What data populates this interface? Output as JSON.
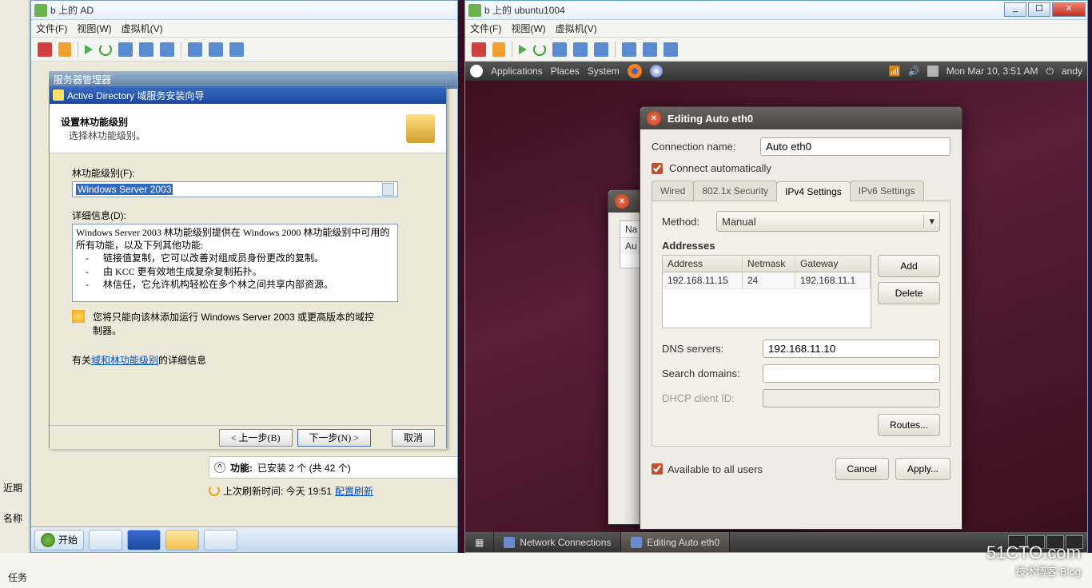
{
  "leftVm": {
    "title": "b 上的 AD",
    "menu": {
      "file": "文件(F)",
      "view": "视图(W)",
      "vm": "虚拟机(V)"
    },
    "srvMgr": "服务器管理器",
    "wizard": {
      "title": "Active Directory 域服务安装向导",
      "headTitle": "设置林功能级别",
      "headSub": "选择林功能级别。",
      "forestLabel": "林功能级别(F):",
      "forestValue": "Windows Server 2003",
      "detailsLabel": "详细信息(D):",
      "details": "Windows Server 2003 林功能级别提供在 Windows 2000 林功能级别中可用的所有功能，以及下列其他功能:\n    -      链接值复制，它可以改善对组成员身份更改的复制。\n    -      由 KCC 更有效地生成复杂复制拓扑。\n    -      林信任，它允许机构轻松在多个林之间共享内部资源。",
      "warn": "您将只能向该林添加运行 Windows Server 2003 或更高版本的域控制器。",
      "linkPrefix": "有关",
      "linkText": "域和林功能级别",
      "linkSuffix": "的详细信息",
      "back": "< 上一步(B)",
      "next": "下一步(N) >",
      "cancel": "取消"
    },
    "funcLabel": "功能:",
    "funcValue": "已安装 2 个 (共 42 个)",
    "refreshLabel": "上次刷新时间: 今天 19:51",
    "refreshLink": "配置刷新",
    "start": "开始",
    "recentLabel": "近期",
    "nameLabel": "名称"
  },
  "rightVm": {
    "title": "b 上的 ubuntu1004",
    "menu": {
      "file": "文件(F)",
      "view": "视图(W)",
      "vm": "虚拟机(V)"
    },
    "panel": {
      "apps": "Applications",
      "places": "Places",
      "system": "System",
      "clock": "Mon Mar 10,  3:51 AM",
      "user": "andy"
    },
    "ncTitle": "Network Connections",
    "ncCol": "Na",
    "ncRow": "Au",
    "edit": {
      "title": "Editing Auto eth0",
      "connLabel": "Connection name:",
      "connValue": "Auto eth0",
      "autoConnect": "Connect automatically",
      "tabs": {
        "wired": "Wired",
        "x8021": "802.1x Security",
        "ipv4": "IPv4 Settings",
        "ipv6": "IPv6 Settings"
      },
      "methodLabel": "Method:",
      "methodValue": "Manual",
      "addresses": "Addresses",
      "cols": {
        "addr": "Address",
        "mask": "Netmask",
        "gw": "Gateway"
      },
      "row": {
        "addr": "192.168.11.15",
        "mask": "24",
        "gw": "192.168.11.1"
      },
      "addBtn": "Add",
      "delBtn": "Delete",
      "dnsLabel": "DNS servers:",
      "dnsValue": "192.168.11.10",
      "searchLabel": "Search domains:",
      "searchValue": "",
      "dhcpLabel": "DHCP client ID:",
      "routesBtn": "Routes...",
      "avail": "Available to all users",
      "cancel": "Cancel",
      "apply": "Apply..."
    },
    "taskbar": {
      "nc": "Network Connections",
      "edit": "Editing Auto eth0"
    }
  },
  "watermark": {
    "main": "51CTO.com",
    "sub": "技术博客    Blog"
  },
  "hostTask": "任务"
}
